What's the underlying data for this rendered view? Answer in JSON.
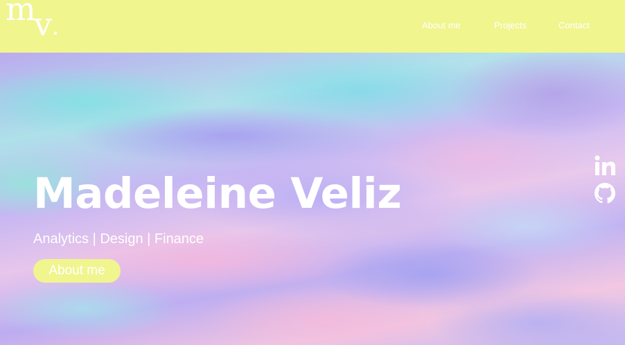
{
  "header": {
    "logo_text_m": "m",
    "logo_text_v": "v",
    "nav": [
      {
        "label": "About me"
      },
      {
        "label": "Projects"
      },
      {
        "label": "Contact"
      }
    ]
  },
  "hero": {
    "title": "Madeleine Veliz",
    "subtitle": "Analytics | Design | Finance",
    "cta_label": "About me"
  },
  "social": [
    {
      "icon": "linkedin-icon"
    },
    {
      "icon": "github-icon"
    }
  ],
  "colors": {
    "accent_yellow": "#f0f58e",
    "text": "#ffffff"
  }
}
